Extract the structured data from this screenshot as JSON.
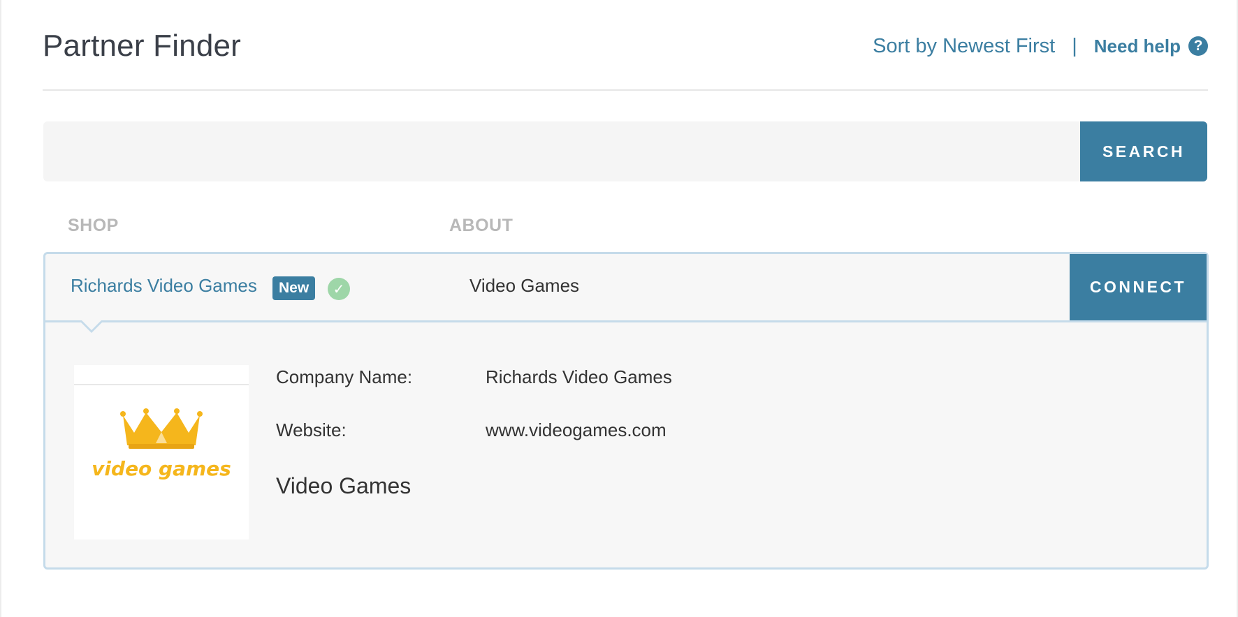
{
  "header": {
    "title": "Partner Finder",
    "sort_label": "Sort by Newest First",
    "divider": "|",
    "help_label": "Need help",
    "help_icon": "question-circle-icon",
    "help_icon_glyph": "?"
  },
  "search": {
    "value": "",
    "placeholder": "",
    "button_label": "SEARCH"
  },
  "columns": {
    "shop": "SHOP",
    "about": "ABOUT"
  },
  "partner": {
    "shop_name": "Richards Video Games",
    "badge": "New",
    "verified_icon": "check-circle-icon",
    "verified_glyph": "✓",
    "about": "Video Games",
    "connect_label": "CONNECT",
    "details": {
      "company_name_label": "Company Name:",
      "company_name": "Richards Video Games",
      "website_label": "Website:",
      "website": "www.videogames.com",
      "about": "Video Games"
    },
    "logo": {
      "icon": "crown-icon",
      "text": "video games"
    }
  },
  "colors": {
    "accent": "#3b7ea1",
    "card_border": "#c5dbea",
    "verified": "#9ed6a8",
    "logo": "#f5b61c"
  }
}
